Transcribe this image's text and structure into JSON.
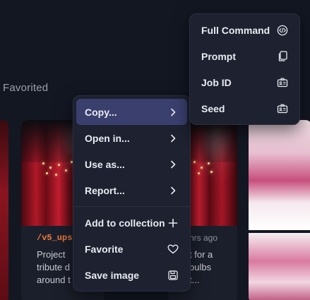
{
  "section": {
    "title": "Favorited"
  },
  "cards": [
    {
      "tag": "/v5_ups",
      "description": "Project\ntribute d\naround t"
    },
    {
      "time": "hrs ago",
      "description": "t for a\nbulbs\nt..."
    }
  ],
  "context_menu": {
    "items": [
      {
        "label": "Copy...",
        "icon": "chevron-right-icon",
        "active": true
      },
      {
        "label": "Open in...",
        "icon": "chevron-right-icon"
      },
      {
        "label": "Use as...",
        "icon": "chevron-right-icon"
      },
      {
        "label": "Report...",
        "icon": "chevron-right-icon"
      },
      {
        "label": "Add to collection",
        "icon": "plus-icon"
      },
      {
        "label": "Favorite",
        "icon": "heart-icon"
      },
      {
        "label": "Save image",
        "icon": "floppy-disk-icon"
      }
    ]
  },
  "copy_submenu": {
    "items": [
      {
        "label": "Full Command",
        "icon": "code-icon"
      },
      {
        "label": "Prompt",
        "icon": "copy-icon"
      },
      {
        "label": "Job ID",
        "icon": "id-card-icon"
      },
      {
        "label": "Seed",
        "icon": "id-card-icon"
      }
    ]
  },
  "colors": {
    "background": "#131722",
    "menu_bg": "#1d2130",
    "active_item": "#3b3f6e",
    "tag_accent": "#f07a3a"
  }
}
